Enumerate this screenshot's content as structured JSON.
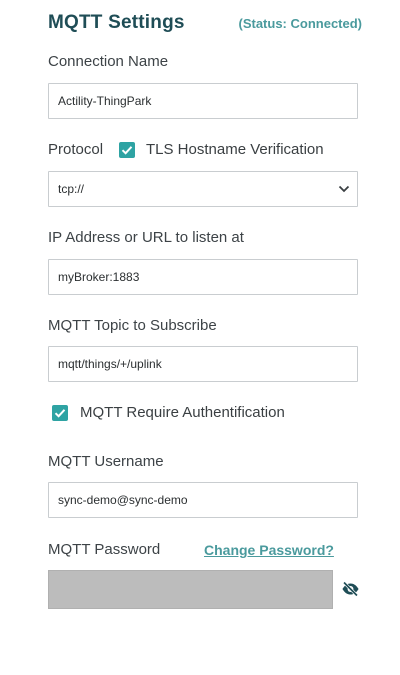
{
  "header": {
    "title": "MQTT Settings",
    "status": "(Status: Connected)"
  },
  "connection_name": {
    "label": "Connection Name",
    "value": "Actility-ThingPark"
  },
  "protocol": {
    "label": "Protocol",
    "tls_checkbox_checked": true,
    "tls_label": "TLS Hostname Verification",
    "selected": "tcp://"
  },
  "ip_address": {
    "label": "IP Address or URL to listen at",
    "value": "myBroker:1883"
  },
  "topic": {
    "label": "MQTT Topic to Subscribe",
    "value": "mqtt/things/+/uplink"
  },
  "auth": {
    "checked": true,
    "label": "MQTT Require Authentification"
  },
  "username": {
    "label": "MQTT Username",
    "value": "sync-demo@sync-demo"
  },
  "password": {
    "label": "MQTT Password",
    "change_link": "Change Password?",
    "value": "",
    "toggle_icon": "eye-slash-icon"
  },
  "colors": {
    "accent": "#2ea3a3",
    "title": "#1f4d56",
    "link": "#4a9a9d",
    "disabled_field": "#bcbcbc"
  }
}
